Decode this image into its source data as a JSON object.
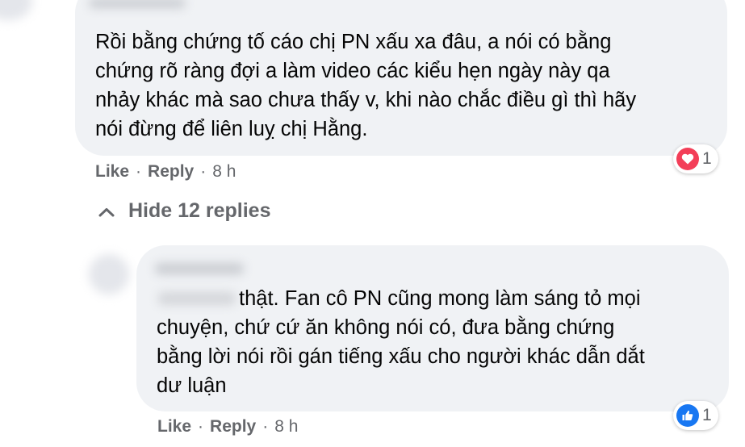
{
  "comment1": {
    "text": "Rồi bằng chứng tố cáo chị PN xấu xa đâu, a nói có bằng\nchứng rõ ràng đợi a làm video các kiểu hẹn ngày này qa\nnhảy khác mà sao chưa thấy v, khi nào chắc điều gì thì hãy\nnói đừng để liên luỵ chị Hằng.",
    "like_label": "Like",
    "reply_label": "Reply",
    "time": "8 h",
    "reaction_icon": "love-icon",
    "reaction_count": "1"
  },
  "hide_replies_label": "Hide 12 replies",
  "reply1": {
    "text": "thật. Fan cô PN cũng mong làm sáng tỏ mọi\nchuyện, chứ cứ ăn không nói có, đưa bằng chứng\nbằng lời nói rồi gán tiếng xấu cho người khác dẫn dắt\ndư luận",
    "like_label": "Like",
    "reply_label": "Reply",
    "time": "8 h",
    "reaction_icon": "like-thumb-icon",
    "reaction_count": "1"
  },
  "colors": {
    "bubble": "#f0f2f5",
    "secondary_text": "#65676b",
    "love": "#f33e58",
    "like": "#1877f2"
  }
}
